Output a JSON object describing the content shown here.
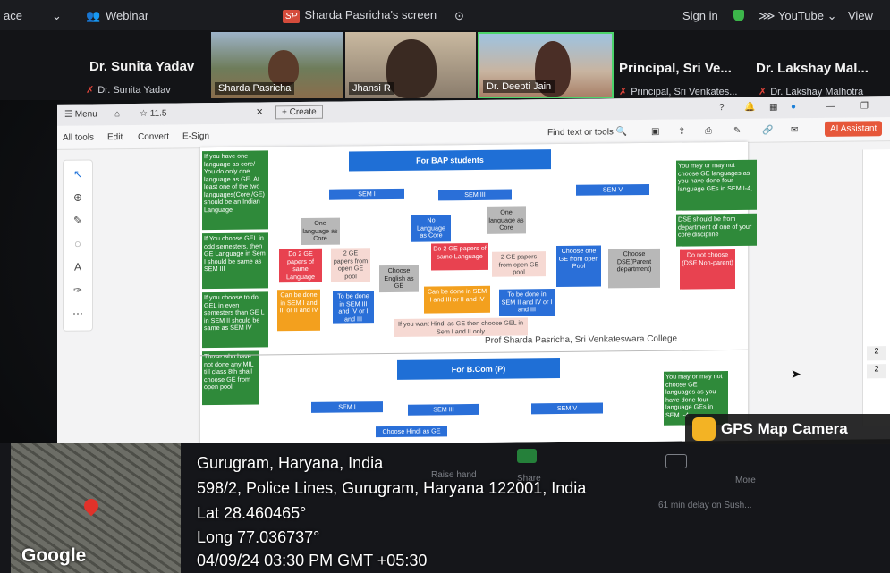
{
  "zoom": {
    "app_label": "ace",
    "webinar": "Webinar",
    "sp_badge": "SP",
    "screen_share": "Sharda Pasricha's screen",
    "sign_in": "Sign in",
    "youtube": "YouTube",
    "view": "View"
  },
  "participants": [
    {
      "big": "Dr. Sunita Yadav",
      "sub": "Dr. Sunita Yadav"
    },
    {
      "tile": "Sharda Pasricha"
    },
    {
      "tile": "Jhansi R"
    },
    {
      "tile": "Dr. Deepti Jain"
    },
    {
      "big": "Principal, Sri Ve...",
      "sub": "Principal, Sri Venkates..."
    },
    {
      "big": "Dr. Lakshay Mal...",
      "sub": "Dr. Lakshay Malhotra"
    }
  ],
  "viewer": {
    "menu": "Menu",
    "tab_zoom": "11.5",
    "create": "Create",
    "tools": [
      "All tools",
      "Edit",
      "Convert",
      "E-Sign"
    ],
    "find": "Find text or tools",
    "ai": "AI Assistant"
  },
  "doc": {
    "bap_title": "For BAP students",
    "sem1": "SEM I",
    "sem3": "SEM III",
    "sem5": "SEM V",
    "g1": "If you have one language as core/ You do only one language as GE. At least one of the two languages(Core /GE) should be an Indian Language",
    "g2": "If You choose GEL in odd semesters, then GE Language in Sem I should be same as SEM III",
    "g3": "If you choose to do GEL in even semesters than GE L in SEM II should be same as SEM IV",
    "g4": "Those who have not done any MIL till class 8th shall choose GE from open pool",
    "g5": "You may or may not choose GE languages as you have done four language GEs in SEM I-4,",
    "g6": "DSE should be from department of one of your core discipline",
    "one_lang_core": "One language as Core",
    "no_lang_core": "No Language as Core",
    "one_lang_core2": "One language as Core",
    "do2": "Do 2 GE papers of same Language",
    "two_ge_open": "2 GE papers from open GE pool",
    "choose_eng": "Choose English as GE",
    "do2b": "Do 2 GE papers of same Language",
    "two_ge_open2": "2 GE papers from open GE pool",
    "choose_one_ge": "Choose one GE from open Pool",
    "choose_dse": "Choose DSE(Parent department)",
    "do_not": "Do not choose (DSE Non-parent)",
    "can_be_done": "Can be done in SEM I and III or II and IV",
    "to_be_done": "To be done in SEM III and IV or I and III",
    "can_be_done2": "Can be done in SEM I and III or II and IV",
    "to_be_done2": "To be done in SEM II and IV or I and III",
    "hindi_note": "If you want Hindi as GE then choose GEL in Sem I and II only",
    "credit": "Prof Sharda Pasricha, Sri Venkateswara College",
    "bcom_title": "For B.Com (P)",
    "bsem1": "SEM I",
    "bsem3": "SEM III",
    "bsem5": "SEM V",
    "hindi_ge": "Choose Hindi as GE",
    "g7": "You may or may not choose GE languages as you have done four language GEs in SEM I-4"
  },
  "overlay": {
    "brand": "GPS Map Camera",
    "city": "Gurugram, Haryana, India",
    "address": "598/2, Police Lines, Gurugram, Haryana 122001, India",
    "lat": "Lat 28.460465°",
    "long": "Long 77.036737°",
    "datetime": "04/09/24 03:30 PM GMT +05:30",
    "google": "Google"
  },
  "dim_bar": {
    "raise": "Raise hand",
    "share": "Share",
    "more": "More",
    "delay": "61 min delay on Sush..."
  }
}
